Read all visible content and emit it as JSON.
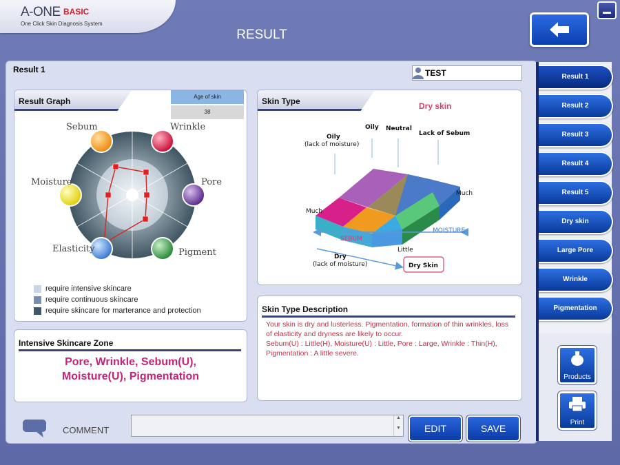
{
  "app": {
    "logo_main": "A-ONE",
    "logo_basic": "BASIC",
    "logo_sub": "One Click Skin Diagnosis System",
    "title": "RESULT"
  },
  "header": {
    "back_icon": "arrow-left-icon",
    "minimize_icon": "minimize-icon"
  },
  "main": {
    "result_label": "Result 1",
    "user_name": "TEST"
  },
  "result_graph": {
    "title": "Result Graph",
    "age_header": "Age of skin",
    "age_value": "38",
    "labels": {
      "sebum": "Sebum",
      "wrinkle": "Wrinkle",
      "pore": "Pore",
      "pigment": "Pigment",
      "elasticity": "Elasticity",
      "moisture": "Moisture"
    },
    "legend": [
      {
        "label": "require intensive skincare",
        "color": "#c9d6ea"
      },
      {
        "label": "require continuous skincare",
        "color": "#7a8fb0"
      },
      {
        "label": "require skincare for marterance and protection",
        "color": "#3f5766"
      }
    ]
  },
  "skin_type": {
    "title": "Skin Type",
    "value": "Dry skin",
    "oily_label": "Oily",
    "oily_sub": "(lack of moisture)",
    "oily_top": "Oily",
    "neutral": "Neutral",
    "lack_of_sebum": "Lack of Sebum",
    "much_left": "Much",
    "much_right": "Much",
    "sebum": "SEBUM",
    "moisture": "MOISTURE",
    "little": "Little",
    "dry_label": "Dry",
    "dry_sub": "(lack of moisture)",
    "dry_skin_callout": "Dry Skin"
  },
  "intensive_zone": {
    "title": "Intensive Skincare Zone",
    "line1": "Pore, Wrinkle, Sebum(U),",
    "line2": "Moisture(U), Pigmentation"
  },
  "description": {
    "title": "Skin Type Description",
    "text": "Your skin is dry and lusterless. Pigmentation, formation of thin wrinkles, loss of elasticity and dryness are likely to occur.\n Sebum(U) : Little(H), Moisture(U) : Little, Pore : Large, Wrinkle : Thin(H), Pigmentation : A little severe."
  },
  "comment": {
    "label": "COMMENT",
    "value": ""
  },
  "buttons": {
    "edit": "EDIT",
    "save": "SAVE",
    "products": "Products",
    "print": "Print"
  },
  "sidebar": {
    "items": [
      {
        "label": "Result 1"
      },
      {
        "label": "Result 2"
      },
      {
        "label": "Result 3"
      },
      {
        "label": "Result 4"
      },
      {
        "label": "Result 5"
      },
      {
        "label": "Dry skin"
      },
      {
        "label": "Large Pore"
      },
      {
        "label": "Wrinkle"
      },
      {
        "label": "Pigmentation"
      }
    ]
  }
}
